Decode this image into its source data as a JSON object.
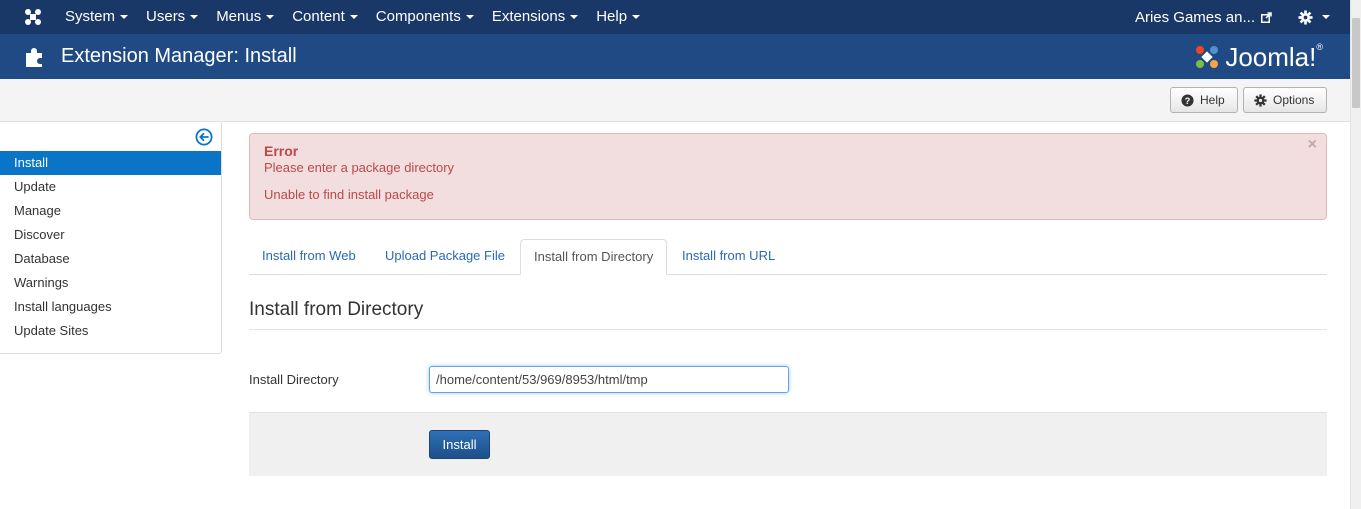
{
  "navbar": {
    "menus": [
      {
        "label": "System"
      },
      {
        "label": "Users"
      },
      {
        "label": "Menus"
      },
      {
        "label": "Content"
      },
      {
        "label": "Components"
      },
      {
        "label": "Extensions"
      },
      {
        "label": "Help"
      }
    ],
    "site_link": "Aries Games an..."
  },
  "header": {
    "title": "Extension Manager: Install",
    "brand": "Joomla!",
    "brand_mark": "®"
  },
  "toolbar": {
    "help_label": "Help",
    "options_label": "Options"
  },
  "sidebar": {
    "items": [
      {
        "label": "Install",
        "active": true
      },
      {
        "label": "Update"
      },
      {
        "label": "Manage"
      },
      {
        "label": "Discover"
      },
      {
        "label": "Database"
      },
      {
        "label": "Warnings"
      },
      {
        "label": "Install languages"
      },
      {
        "label": "Update Sites"
      }
    ]
  },
  "alert": {
    "heading": "Error",
    "messages": [
      "Please enter a package directory",
      "Unable to find install package"
    ],
    "close": "×"
  },
  "tabs": [
    {
      "label": "Install from Web"
    },
    {
      "label": "Upload Package File"
    },
    {
      "label": "Install from Directory",
      "active": true
    },
    {
      "label": "Install from URL"
    }
  ],
  "main": {
    "section_title": "Install from Directory",
    "field_label": "Install Directory",
    "field_value": "/home/content/53/969/8953/html/tmp",
    "install_button": "Install"
  },
  "colors": {
    "navbar": "#1a3867",
    "header": "#1f4a84",
    "active_item": "#0a74c7",
    "alert_bg": "#f2dede",
    "alert_text": "#b94a48",
    "link": "#2a69b8"
  }
}
